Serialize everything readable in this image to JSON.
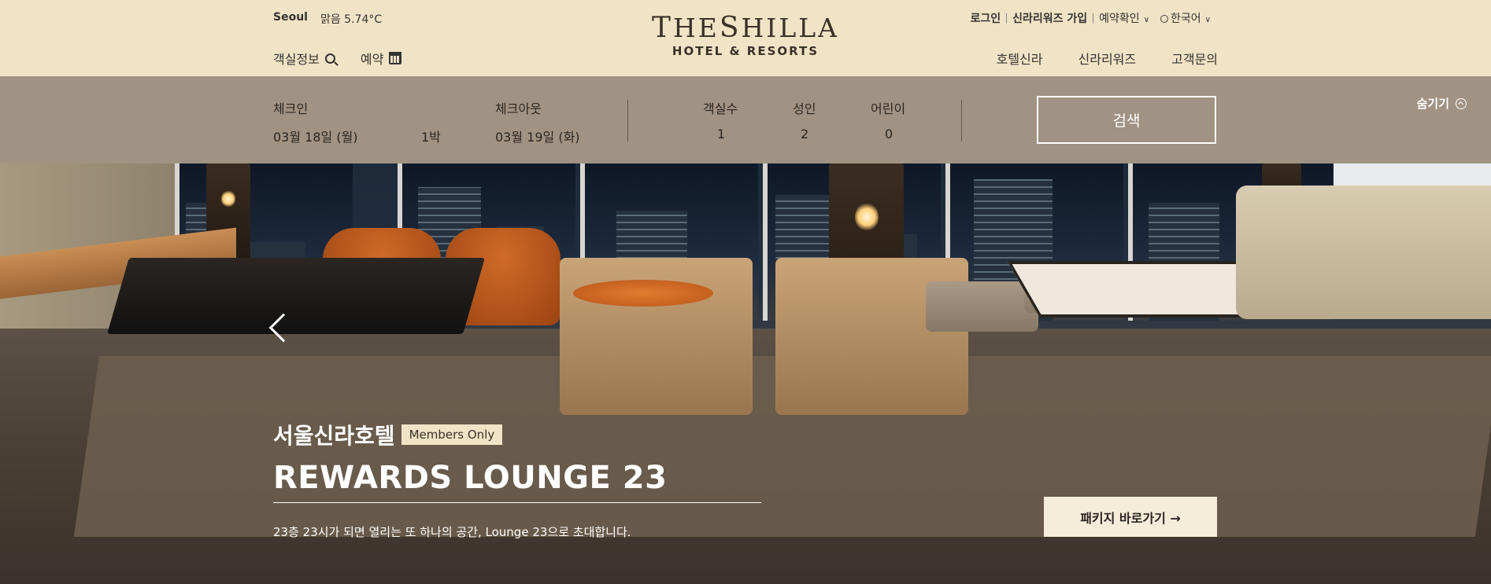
{
  "weather": {
    "city": "Seoul",
    "condition": "맑음 5.74°C"
  },
  "logo": {
    "mark_t": "T",
    "mark_he": "HE",
    "mark_s": "S",
    "mark_hilla": "HILLA",
    "sub": "HOTEL & RESORTS"
  },
  "util": {
    "login": "로그인",
    "join": "신라리워즈 가입",
    "reservation_check": "예약확인",
    "language": "한국어"
  },
  "quick": {
    "rooms": "객실정보",
    "reserve": "예약"
  },
  "gnb": [
    "호텔신라",
    "신라리워즈",
    "고객문의"
  ],
  "booking": {
    "checkin_label": "체크인",
    "checkin_value": "03월 18일 (월)",
    "nights": "1박",
    "checkout_label": "체크아웃",
    "checkout_value": "03월 19일 (화)",
    "rooms_label": "객실수",
    "rooms_value": "1",
    "adults_label": "성인",
    "adults_value": "2",
    "children_label": "어린이",
    "children_value": "0",
    "search": "검색",
    "hide": "숨기기"
  },
  "hero": {
    "hotel": "서울신라호텔",
    "badge": "Members Only",
    "title": "REWARDS LOUNGE 23",
    "desc": "23층 23시가 되면 열리는 또 하나의 공간, Lounge 23으로 초대합니다.",
    "cta": "패키지 바로가기 →"
  },
  "colors": {
    "header_bg": "#f1e3c5",
    "booking_bg": "#a09383",
    "badge_bg": "#f1e3c5"
  }
}
